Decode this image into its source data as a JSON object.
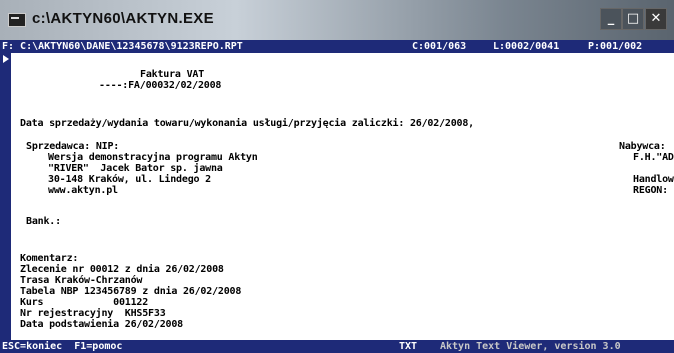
{
  "window": {
    "title": "c:\\AKTYN60\\AKTYN.EXE",
    "buttons": {
      "minimize": "_",
      "maximize": "□",
      "close": "✕"
    }
  },
  "status": {
    "file": "F: C:\\AKTYN60\\DANE\\12345678\\9123REPO.RPT",
    "column": "C:001/063",
    "line": "L:0002/0041",
    "page": "P:001/002"
  },
  "document": {
    "title": "Faktura VAT",
    "number": "----:FA/00032/02/2008",
    "sale_date_line": "Data sprzedaży/wydania towaru/wykonania usługi/przyjęcia zaliczki: 26/02/2008,",
    "seller_label": "Sprzedawca: NIP:",
    "seller_name": "Wersja demonstracyjna programu Aktyn",
    "seller_company": "\"RIVER\"  Jacek Bator sp. jawna",
    "seller_address": "30-148 Kraków, ul. Lindego 2",
    "seller_web": "www.aktyn.pl",
    "buyer_label": "Nabywca:",
    "buyer_name": "F.H.\"AD",
    "buyer_trade": "Handlow",
    "buyer_regon": "REGON:",
    "bank_label": "Bank.:",
    "comments_label": "Komentarz:",
    "comments": [
      "Zlecenie nr 00012 z dnia 26/02/2008",
      "Trasa Kraków-Chrzanów",
      "Tabela NBP 123456789 z dnia 26/02/2008",
      "Kurs            001122",
      "Nr rejestracyjny  KHS5F33",
      "Data podstawienia 26/02/2008"
    ]
  },
  "bottom": {
    "escape_hint": "ESC=koniec  F1=pomoc",
    "mode": "TXT",
    "viewer": "Aktyn Text Viewer, version 3.0"
  }
}
